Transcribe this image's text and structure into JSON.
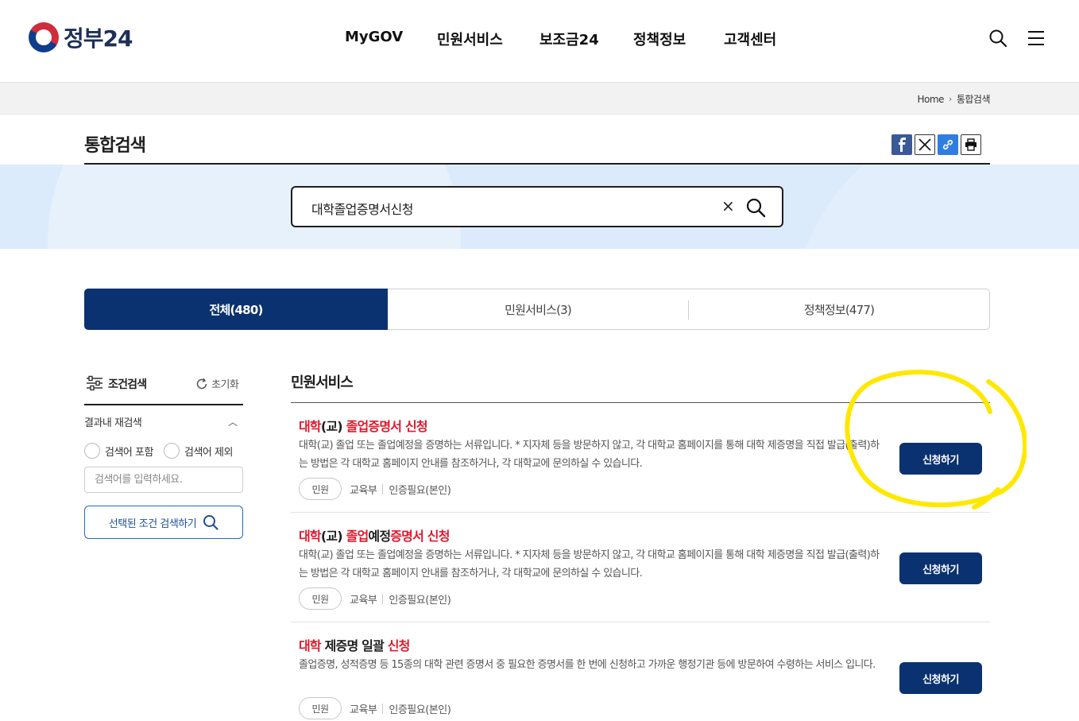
{
  "header": {
    "logo_text": "정부24",
    "nav": [
      "MyGOV",
      "민원서비스",
      "보조금24",
      "정책정보",
      "고객센터"
    ],
    "search_icon": "search-icon",
    "menu_icon": "hamburger-menu-icon"
  },
  "breadcrumb": {
    "home": "Home",
    "current": "통합검색"
  },
  "page": {
    "title": "통합검색",
    "share_icons": [
      "facebook-icon",
      "x-twitter-icon",
      "link-icon",
      "print-icon"
    ]
  },
  "search": {
    "query": "대학졸업증명서신청",
    "clear_label": "×"
  },
  "tabs": [
    {
      "label": "전체(480)",
      "active": true
    },
    {
      "label": "민원서비스(3)",
      "active": false
    },
    {
      "label": "정책정보(477)",
      "active": false
    }
  ],
  "sidebar": {
    "title": "조건검색",
    "reset_label": "초기화",
    "refine_label": "결과내 재검색",
    "include_label": "검색어 포함",
    "exclude_label": "검색어 제외",
    "input_placeholder": "검색어를 입력하세요.",
    "search_button": "선택된 조건 검색하기"
  },
  "results": {
    "section_title": "민원서비스",
    "items": [
      {
        "title_parts": [
          {
            "text": "대학",
            "hl": true
          },
          {
            "text": "(교) ",
            "hl": false
          },
          {
            "text": "졸업증명서",
            "hl": true
          },
          {
            "text": " ",
            "hl": false
          },
          {
            "text": "신청",
            "hl": true
          }
        ],
        "desc": "대학(교) 졸업 또는 졸업예정을 증명하는 서류입니다. * 지자체 등을 방문하지 않고, 각 대학교 홈페이지를 통해 대학 제증명을 직접 발급(출력)하는 방법은 각 대학교 홈페이지 안내를 참조하거나, 각 대학교에 문의하실 수 있습니다.",
        "badge": "민원",
        "dept": "교육부",
        "auth": "인증필요(본인)",
        "button": "신청하기"
      },
      {
        "title_parts": [
          {
            "text": "대학",
            "hl": true
          },
          {
            "text": "(교) ",
            "hl": false
          },
          {
            "text": "졸업",
            "hl": true
          },
          {
            "text": "예정",
            "hl": false
          },
          {
            "text": "증명서",
            "hl": true
          },
          {
            "text": " ",
            "hl": false
          },
          {
            "text": "신청",
            "hl": true
          }
        ],
        "desc": "대학(교) 졸업 또는 졸업예정을 증명하는 서류입니다. * 지자체 등을 방문하지 않고, 각 대학교 홈페이지를 통해 대학 제증명을 직접 발급(출력)하는 방법은 각 대학교 홈페이지 안내를 참조하거나, 각 대학교에 문의하실 수 있습니다.",
        "badge": "민원",
        "dept": "교육부",
        "auth": "인증필요(본인)",
        "button": "신청하기"
      },
      {
        "title_parts": [
          {
            "text": "대학",
            "hl": true
          },
          {
            "text": " 제증명 일괄 ",
            "hl": false
          },
          {
            "text": "신청",
            "hl": true
          }
        ],
        "desc": "졸업증명, 성적증명 등 15종의 대학 관련 증명서 중 필요한 증명서를 한 번에 신청하고 가까운 행정기관 등에 방문하여 수령하는 서비스 입니다.",
        "badge": "민원",
        "dept": "교육부",
        "auth": "인증필요(본인)",
        "button": "신청하기"
      }
    ]
  },
  "colors": {
    "primary": "#0b3270",
    "highlight": "#e0182c",
    "band": "#dcebfb",
    "annotation": "#ffe800"
  }
}
